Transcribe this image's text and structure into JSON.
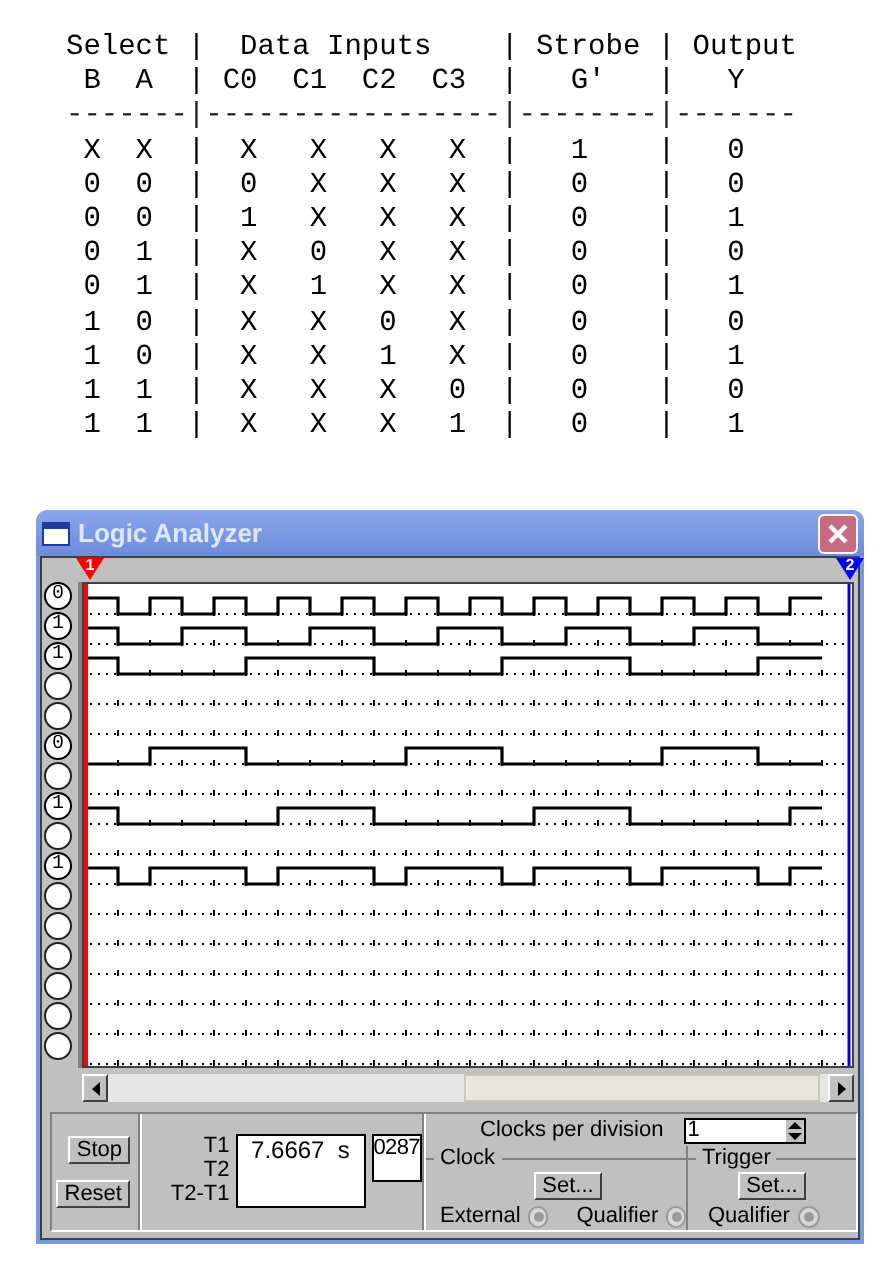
{
  "truth_table": {
    "lines": [
      {
        "kind": "header",
        "text": "Select |  Data Inputs    | Strobe | Output"
      },
      {
        "kind": "header",
        "text": " B  A  | C0  C1  C2  C3  |   G'   |   Y"
      },
      {
        "kind": "rule",
        "text": "-------|-----------------|--------|-------"
      },
      {
        "kind": "row",
        "text": " X  X  |  X   X   X   X  |   1    |   0"
      },
      {
        "kind": "row",
        "text": " 0  0  |  0   X   X   X  |   0    |   0"
      },
      {
        "kind": "row",
        "text": " 0  0  |  1   X   X   X  |   0    |   1"
      },
      {
        "kind": "row",
        "text": " 0  1  |  X   0   X   X  |   0    |   0"
      },
      {
        "kind": "row",
        "text": " 0  1  |  X   1   X   X  |   0    |   1"
      },
      {
        "kind": "row",
        "text": " 1  0  |  X   X   0   X  |   0    |   0"
      },
      {
        "kind": "row",
        "text": " 1  0  |  X   X   1   X  |   0    |   1"
      },
      {
        "kind": "row",
        "text": " 1  1  |  X   X   X   0  |   0    |   0"
      },
      {
        "kind": "row",
        "text": " 1  1  |  X   X   X   1  |   0    |   1"
      }
    ]
  },
  "window": {
    "title": "Logic Analyzer"
  },
  "cursors": [
    {
      "label": "1",
      "color": "#ff0000"
    },
    {
      "label": "2",
      "color": "#0000ff"
    }
  ],
  "channels": [
    {
      "connected": true,
      "value": "0"
    },
    {
      "connected": true,
      "value": "1"
    },
    {
      "connected": true,
      "value": "1"
    },
    {
      "connected": false
    },
    {
      "connected": false
    },
    {
      "connected": true,
      "value": "0"
    },
    {
      "connected": false
    },
    {
      "connected": true,
      "value": "1"
    },
    {
      "connected": false
    },
    {
      "connected": true,
      "value": "1"
    },
    {
      "connected": false
    },
    {
      "connected": false
    },
    {
      "connected": false
    },
    {
      "connected": false
    },
    {
      "connected": false
    },
    {
      "connected": false
    }
  ],
  "buttons": [
    "Stop",
    "Reset"
  ],
  "time": {
    "labels": [
      "T1",
      "T2",
      "T2-T1"
    ],
    "t1": "7.6667  s",
    "counter": "0287"
  },
  "clocks_per_division": {
    "label": "Clocks per division",
    "value": "1"
  },
  "clock": {
    "title": "Clock",
    "button": "Set...",
    "options": [
      {
        "label": "External",
        "disabled": true
      },
      {
        "label": "Qualifier",
        "disabled": true
      }
    ]
  },
  "trigger": {
    "title": "Trigger",
    "button": "Set...",
    "options": [
      {
        "label": "Qualifier",
        "disabled": true
      }
    ]
  }
}
